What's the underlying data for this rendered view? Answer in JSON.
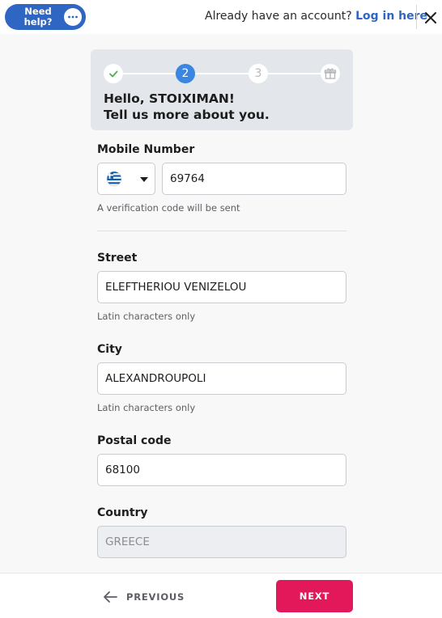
{
  "header": {
    "help_label": "Need\nhelp?",
    "chat_icon": "chat-bubble-icon",
    "account_text": "Already have an account? ",
    "login_label": "Log in here",
    "close_icon": "close-icon"
  },
  "stepper": {
    "steps": [
      {
        "state": "completed",
        "icon": "check-icon",
        "label": ""
      },
      {
        "state": "active",
        "label": "2"
      },
      {
        "state": "upcoming",
        "label": "3"
      },
      {
        "state": "upcoming",
        "icon": "gift-icon",
        "label": ""
      }
    ],
    "greeting_line1": "Hello, STOIXIMAN!",
    "greeting_line2": "Tell us more about you."
  },
  "form": {
    "mobile": {
      "label": "Mobile Number",
      "country_flag": "greece-flag-icon",
      "value": "69764",
      "hint": "A verification code will be sent"
    },
    "street": {
      "label": "Street",
      "value": "ELEFTHERIOU VENIZELOU",
      "hint": "Latin characters only"
    },
    "city": {
      "label": "City",
      "value": "ALEXANDROUPOLI",
      "hint": "Latin characters only"
    },
    "postal": {
      "label": "Postal code",
      "value": "68100"
    },
    "country": {
      "label": "Country",
      "value": "GREECE",
      "disabled": true
    }
  },
  "footer": {
    "previous_label": "PREVIOUS",
    "next_label": "NEXT"
  },
  "colors": {
    "brand_blue": "#2f66c3",
    "step_active": "#3a86e0",
    "next_pink": "#e2185a",
    "check_green": "#4caf50"
  }
}
